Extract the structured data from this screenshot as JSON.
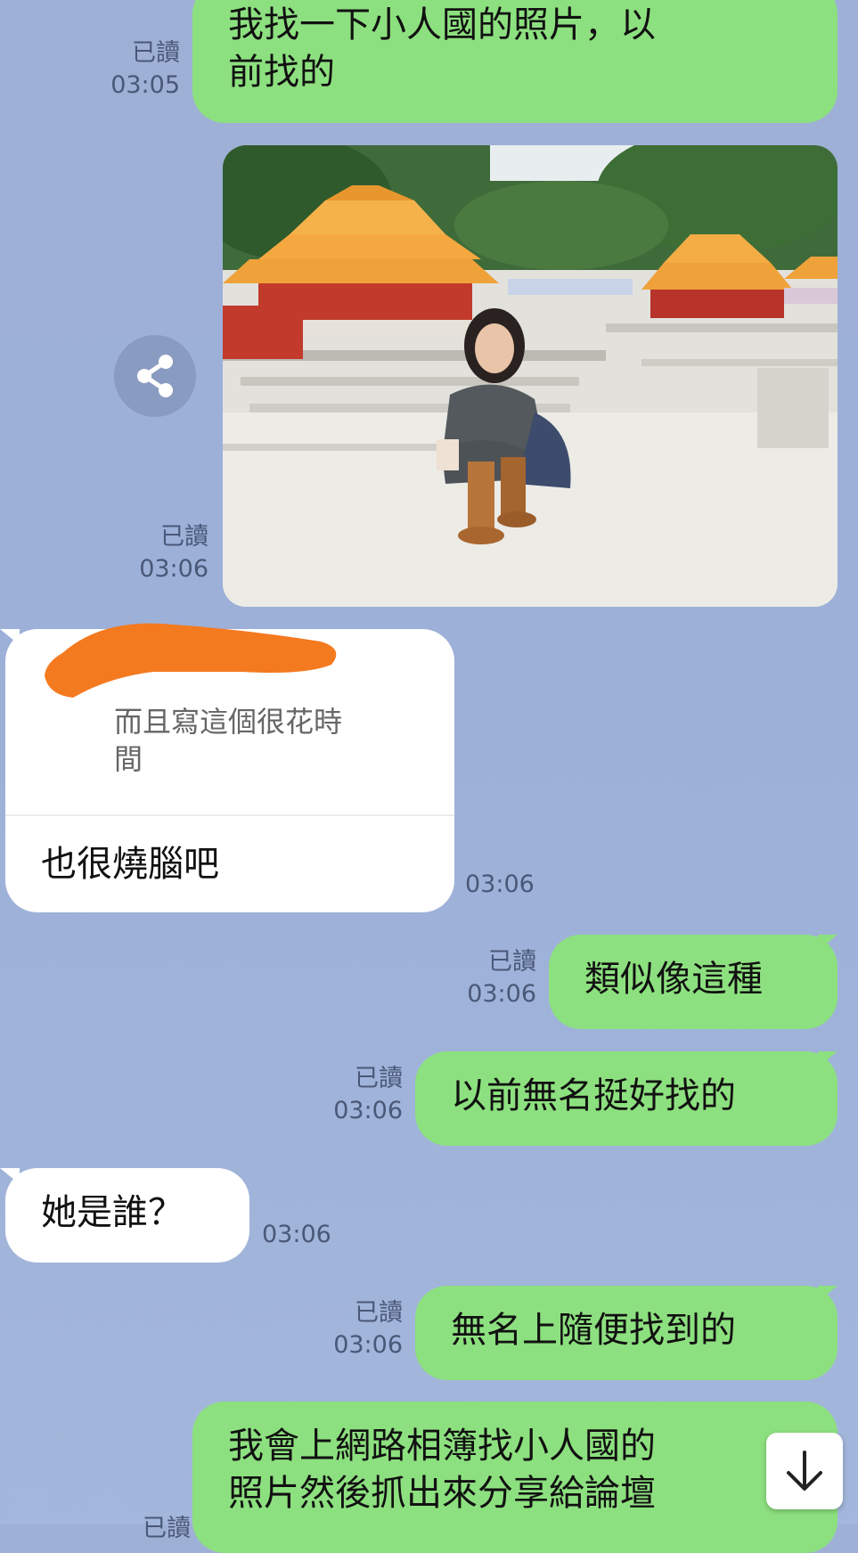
{
  "messages": [
    {
      "dir": "out",
      "text": "我找一下小人國的照片，以前找的",
      "read": "已讀",
      "time": "03:05"
    },
    {
      "dir": "out",
      "type": "photo",
      "read": "已讀",
      "time": "03:06",
      "image_desc": "miniature palace"
    },
    {
      "dir": "in",
      "reply_quote": "而且寫這個很花時間",
      "text": "也很燒腦吧",
      "time": "03:06"
    },
    {
      "dir": "out",
      "text": "類似像這種",
      "read": "已讀",
      "time": "03:06"
    },
    {
      "dir": "out",
      "text": "以前無名挺好找的",
      "read": "已讀",
      "time": "03:06"
    },
    {
      "dir": "in",
      "text": "她是誰？",
      "time": "03:06"
    },
    {
      "dir": "out",
      "text": "無名上隨便找到的",
      "read": "已讀",
      "time": "03:06"
    },
    {
      "dir": "out",
      "text": "我會上網路相簿找小人國的照片然後抓出來分享給論壇",
      "read": "已讀",
      "time": ""
    }
  ],
  "msg1_line1": "我找一下小人國的照片，以",
  "msg1_line2": "前找的",
  "last_line1": "我會上網路相簿找小人國的",
  "last_line2": "照片然後抓出來分享給論壇",
  "reply_quote_line1": "而且寫這個很花時",
  "reply_quote_line2": "間",
  "icons": {
    "share": "share-icon",
    "scroll_down": "arrow-down-icon"
  },
  "colors": {
    "background": "#9fb0d6",
    "outgoing": "#8de07f",
    "incoming": "#ffffff",
    "redaction": "#f47a20"
  }
}
